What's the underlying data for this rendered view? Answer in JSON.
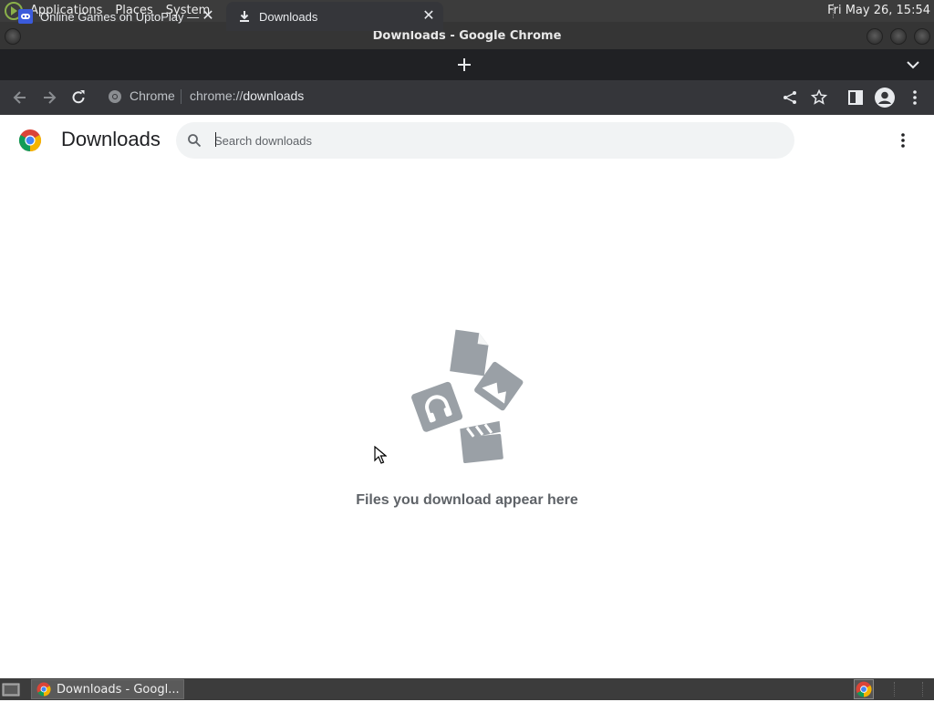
{
  "system_panel": {
    "menus": [
      "Applications",
      "Places",
      "System"
    ],
    "clock": "Fri May 26, 15:54"
  },
  "window": {
    "title": "Downloads - Google Chrome"
  },
  "tabs": [
    {
      "title": "Online Games on UptoPlay —",
      "active": false,
      "icon": "uptoplay-favicon"
    },
    {
      "title": "Downloads",
      "active": true,
      "icon": "download-icon"
    }
  ],
  "toolbar": {
    "site_chip": "Chrome",
    "url_scheme": "chrome://",
    "url_host": "downloads"
  },
  "downloads_page": {
    "title": "Downloads",
    "search_placeholder": "Search downloads",
    "search_value": "",
    "empty_message": "Files you download appear here"
  },
  "taskbar": {
    "task_label": "Downloads - Googl..."
  },
  "colors": {
    "panel_bg": "#3c3c3c",
    "tabstrip_bg": "#202124",
    "toolbar_bg": "#35363a",
    "illustration_gray": "#9aa0a6",
    "empty_text": "#5f6368"
  }
}
